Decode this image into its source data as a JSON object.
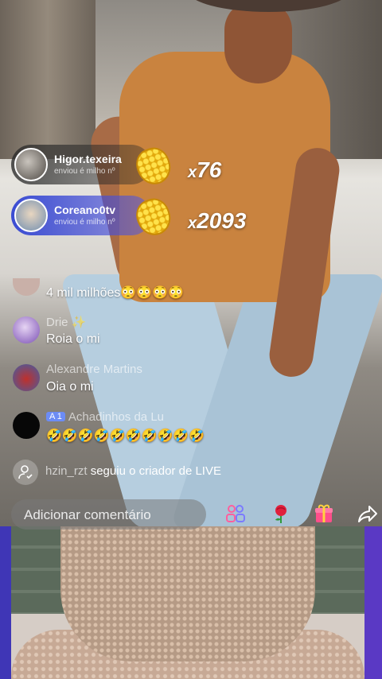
{
  "gifts": [
    {
      "user": "Higor.texeira",
      "sub": "enviou é milho nº",
      "gift_icon": "corn-icon",
      "multiplier_prefix": "x",
      "count": "76"
    },
    {
      "user": "Coreano0tv",
      "sub": "enviou é milho nº",
      "gift_icon": "corn-icon",
      "multiplier_prefix": "x",
      "count": "2093"
    }
  ],
  "chat": [
    {
      "name": "",
      "message": "4 mil milhões",
      "emoji": "😳😳😳😳"
    },
    {
      "name": "Drie ✨",
      "message": "Roia o mi"
    },
    {
      "name": "Alexandre Martins",
      "message": "Oia o mi"
    },
    {
      "badge": "A 1",
      "name": "Achadinhos da Lu",
      "message": "🤣🤣🤣🤣🤣🤣🤣🤣🤣🤣"
    }
  ],
  "follow": {
    "icon": "user-follow-icon",
    "user": "hzin_rzt",
    "text": "seguiu o criador de LIVE"
  },
  "bottom_bar": {
    "comment_placeholder": "Adicionar comentário",
    "icons": [
      "multi-guest-icon",
      "rose-icon",
      "gift-icon",
      "share-icon"
    ]
  },
  "colors": {
    "gift2_banner": "#2c3cd2",
    "side_accent": "#4a37c0"
  }
}
